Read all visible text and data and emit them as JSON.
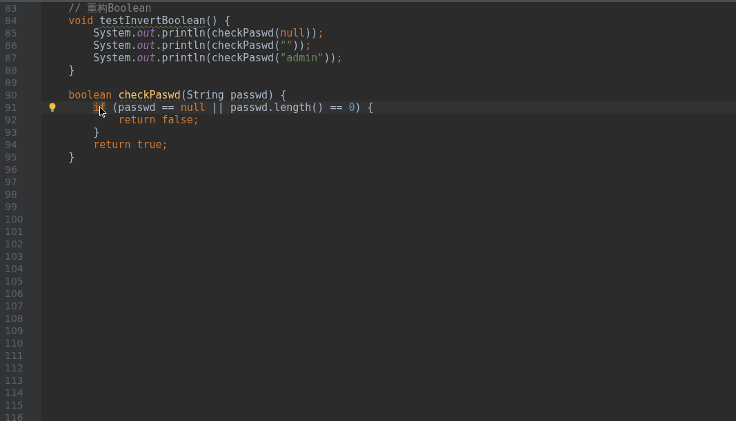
{
  "editor": {
    "lines": [
      {
        "number": "83",
        "current": false,
        "tokens": [
          {
            "text": "    // 重构Boolean",
            "kind": "comment"
          }
        ]
      },
      {
        "number": "84",
        "current": false,
        "tokens": [
          {
            "text": "    void ",
            "kind": "keyword"
          },
          {
            "text": "testInvertBoolean",
            "kind": "typo"
          },
          {
            "text": "() {",
            "kind": "plain"
          }
        ]
      },
      {
        "number": "85",
        "current": false,
        "tokens": [
          {
            "text": "        System.",
            "kind": "plain"
          },
          {
            "text": "out",
            "kind": "field"
          },
          {
            "text": ".println(checkPaswd(",
            "kind": "plain"
          },
          {
            "text": "null",
            "kind": "keyword"
          },
          {
            "text": "))",
            "kind": "plain"
          },
          {
            "text": ";",
            "kind": "keyword"
          }
        ]
      },
      {
        "number": "86",
        "current": false,
        "tokens": [
          {
            "text": "        System.",
            "kind": "plain"
          },
          {
            "text": "out",
            "kind": "field"
          },
          {
            "text": ".println(checkPaswd(",
            "kind": "plain"
          },
          {
            "text": "\"\"",
            "kind": "string"
          },
          {
            "text": "))",
            "kind": "plain"
          },
          {
            "text": ";",
            "kind": "keyword"
          }
        ]
      },
      {
        "number": "87",
        "current": false,
        "tokens": [
          {
            "text": "        System.",
            "kind": "plain"
          },
          {
            "text": "out",
            "kind": "field"
          },
          {
            "text": ".println(checkPaswd(",
            "kind": "plain"
          },
          {
            "text": "\"admin\"",
            "kind": "string"
          },
          {
            "text": "))",
            "kind": "plain"
          },
          {
            "text": ";",
            "kind": "keyword"
          }
        ]
      },
      {
        "number": "88",
        "current": false,
        "tokens": [
          {
            "text": "    }",
            "kind": "plain"
          }
        ]
      },
      {
        "number": "89",
        "current": false
      },
      {
        "number": "90",
        "current": false,
        "tokens": [
          {
            "text": "    boolean ",
            "kind": "keyword"
          },
          {
            "text": "checkPaswd",
            "kind": "method-typo"
          },
          {
            "text": "(String ",
            "kind": "plain"
          },
          {
            "text": "passwd",
            "kind": "typo"
          },
          {
            "text": ") {",
            "kind": "plain"
          }
        ]
      },
      {
        "number": "91",
        "current": true,
        "tokens": [
          {
            "text": "        if",
            "kind": "keyword-highlight"
          },
          {
            "text": " (passwd == ",
            "kind": "plain"
          },
          {
            "text": "null",
            "kind": "keyword"
          },
          {
            "text": " || passwd.length() == ",
            "kind": "plain"
          },
          {
            "text": "0",
            "kind": "number"
          },
          {
            "text": ") {",
            "kind": "plain"
          }
        ]
      },
      {
        "number": "92",
        "current": false,
        "tokens": [
          {
            "text": "            return false;",
            "kind": "keyword"
          }
        ]
      },
      {
        "number": "93",
        "current": false,
        "tokens": [
          {
            "text": "        }",
            "kind": "plain"
          }
        ]
      },
      {
        "number": "94",
        "current": false,
        "tokens": [
          {
            "text": "        return true;",
            "kind": "keyword"
          }
        ]
      },
      {
        "number": "95",
        "current": false,
        "tokens": [
          {
            "text": "    }",
            "kind": "plain"
          }
        ]
      },
      {
        "number": "96",
        "current": false
      },
      {
        "number": "97",
        "current": false
      },
      {
        "number": "98",
        "current": false
      },
      {
        "number": "99",
        "current": false
      },
      {
        "number": "100",
        "current": false
      },
      {
        "number": "101",
        "current": false
      },
      {
        "number": "102",
        "current": false
      },
      {
        "number": "103",
        "current": false
      },
      {
        "number": "104",
        "current": false
      },
      {
        "number": "105",
        "current": false
      },
      {
        "number": "106",
        "current": false
      },
      {
        "number": "107",
        "current": false
      },
      {
        "number": "108",
        "current": false
      },
      {
        "number": "109",
        "current": false
      },
      {
        "number": "110",
        "current": false
      },
      {
        "number": "111",
        "current": false
      },
      {
        "number": "112",
        "current": false
      },
      {
        "number": "113",
        "current": false
      },
      {
        "number": "114",
        "current": false
      },
      {
        "number": "115",
        "current": false
      },
      {
        "number": "116",
        "current": false
      }
    ]
  }
}
